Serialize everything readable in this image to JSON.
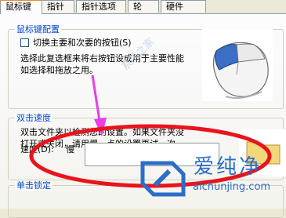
{
  "tabs": [
    {
      "label": "鼠标键"
    },
    {
      "label": "指针"
    },
    {
      "label": "指针选项"
    },
    {
      "label": "轮"
    },
    {
      "label": "硬件"
    }
  ],
  "button_config": {
    "legend": "鼠标键配置",
    "checkbox_label": "切换主要和次要的按钮(S)",
    "checked": false,
    "description_line1": "选择此复选框来将右按钮设成用于主要性能",
    "description_line2": "如选择和拖放之用。"
  },
  "double_click": {
    "legend": "双击速度",
    "description_line1": "双击文件夹以检测您的设置。如果文件夹没",
    "description_line2": "打开或关闭，请用慢一点的设置再试一次。",
    "speed_label": "速度(D):",
    "slow_label": "慢"
  },
  "click_lock": {
    "legend": "单击锁定"
  },
  "watermark": {
    "brand_cn": "爱纯净",
    "brand_en": "aichunjing.com",
    "faint_text": "系统之家"
  },
  "icons": [
    "mouse-icon",
    "folder-icon",
    "arrow-annotation-icon",
    "ellipse-annotation-icon"
  ],
  "colors": {
    "legend": "#0046d5",
    "annotation_arrow": "#e63ee8",
    "annotation_ellipse": "#e8141c",
    "watermark": "#2b6ec8"
  }
}
